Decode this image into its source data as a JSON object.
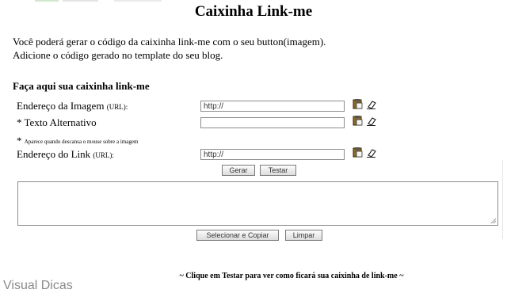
{
  "page": {
    "title": "Caixinha Link-me",
    "intro_line1": "Você poderá gerar o código da caixinha link-me com o seu button(imagem).",
    "intro_line2": "Adicione o código gerado no template do seu blog."
  },
  "form": {
    "section_title": "Faça aqui sua caixinha link-me",
    "image_label": "Endereço da Imagem",
    "image_label_suffix": "(URL):",
    "image_value": "http://",
    "alt_star": "*",
    "alt_label": "Texto Alternativo",
    "alt_value": "",
    "note_star": "*",
    "note_text": "Aparece quando descansa o mouse sobre a imagem",
    "link_label": "Endereço do Link",
    "link_label_suffix": "(URL):",
    "link_value": "http://"
  },
  "buttons": {
    "generate": "Gerar",
    "test": "Testar",
    "select_copy": "Selecionar e Copiar",
    "clear": "Limpar"
  },
  "output": {
    "value": ""
  },
  "footer": {
    "text": "~ Clique em Testar para ver como ficará sua caixinha de link-me ~"
  },
  "credit": {
    "text": "Visual Dicas"
  },
  "icons": {
    "paste": "paste-icon",
    "eraser": "eraser-icon"
  },
  "colors": {
    "border": "#8c8c8c",
    "credit": "#8a8a8a"
  }
}
